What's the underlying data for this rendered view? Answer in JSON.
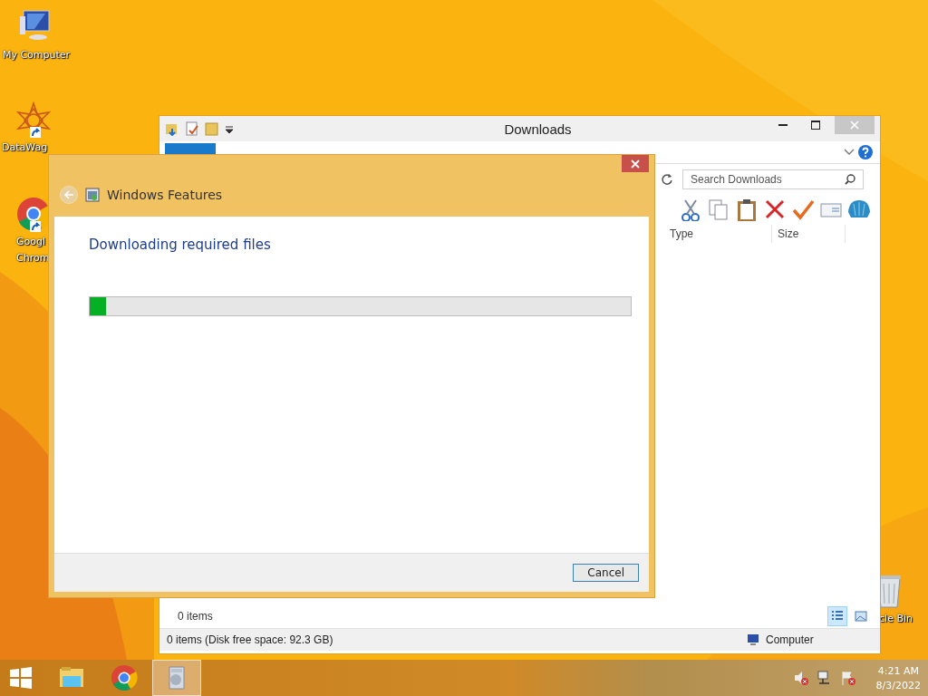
{
  "desktop_icons": [
    {
      "kind": "computer",
      "lines": [
        "My Computer"
      ]
    },
    {
      "kind": "datawagon",
      "lines": [
        "DataWag"
      ]
    },
    {
      "kind": "chrome",
      "lines": [
        "Googl",
        "Chrom"
      ]
    },
    {
      "kind": "recycle",
      "lines": [
        "cle Bin"
      ]
    }
  ],
  "explorer": {
    "title": "Downloads",
    "ribbon_tabs": [
      {
        "selected": true
      }
    ],
    "search": {
      "placeholder": "Search Downloads"
    },
    "columns": [
      "Type",
      "Size"
    ],
    "item_count": "0 items",
    "status_bar": {
      "text": "0 items (Disk free space: 92.3 GB)",
      "location": "Computer"
    },
    "views": [
      {
        "kind": "details",
        "selected": true
      },
      {
        "kind": "large",
        "selected": false
      }
    ]
  },
  "dialog": {
    "title": "Windows Features",
    "heading": "Downloading required files",
    "progress": {
      "level": 0.03
    },
    "button": "Cancel"
  },
  "taskbar": {
    "items": [
      {
        "kind": "explorer",
        "selected": false
      },
      {
        "kind": "chrome",
        "selected": false
      },
      {
        "kind": "features",
        "selected": true
      }
    ],
    "time": "4:21 AM",
    "date": "8/3/2022"
  }
}
